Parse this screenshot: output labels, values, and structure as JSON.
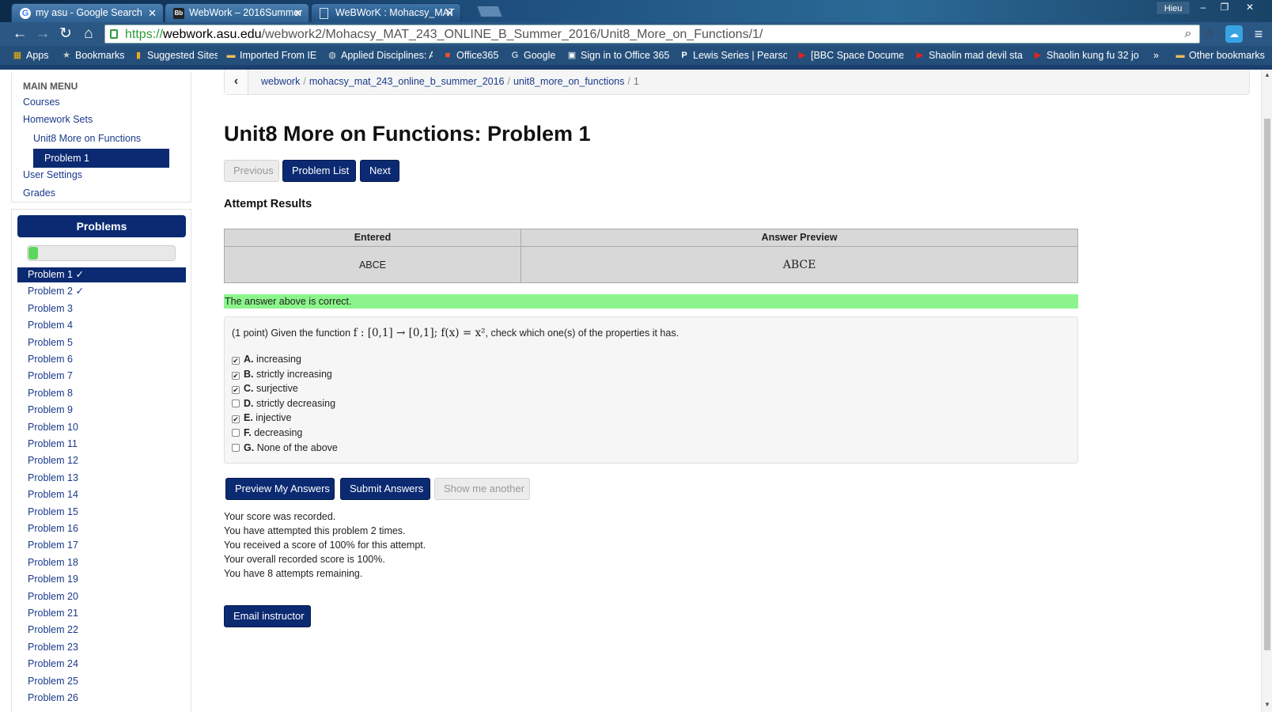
{
  "browser": {
    "tabs": [
      {
        "title": "my asu - Google Search",
        "icon": "google-icon"
      },
      {
        "title": "WebWork – 2016Summer",
        "icon": "blackboard-icon"
      },
      {
        "title": "WeBWorK : Mohacsy_MAT",
        "icon": "document-icon"
      }
    ],
    "window_user": "Hieu",
    "url_scheme": "https://",
    "url_host": "webwork.asu.edu",
    "url_path": "/webwork2/Mohacsy_MAT_243_ONLINE_B_Summer_2016/Unit8_More_on_Functions/1/",
    "bookmarks": [
      {
        "label": "Apps",
        "icon": "apps-grid-icon"
      },
      {
        "label": "Bookmarks",
        "icon": "star-icon"
      },
      {
        "label": "Suggested Sites",
        "icon": "suggested-sites-icon"
      },
      {
        "label": "Imported From IE",
        "icon": "folder-icon"
      },
      {
        "label": "Applied Disciplines: A",
        "icon": "globe-icon"
      },
      {
        "label": "Office365",
        "icon": "office-icon"
      },
      {
        "label": "Google",
        "icon": "google-icon"
      },
      {
        "label": "Sign in to Office 365",
        "icon": "office-icon"
      },
      {
        "label": "Lewis Series | Pearson",
        "icon": "pearson-icon"
      },
      {
        "label": "[BBC Space Documen",
        "icon": "youtube-icon"
      },
      {
        "label": "Shaolin mad devil sta",
        "icon": "youtube-icon"
      },
      {
        "label": "Shaolin kung fu 32 jo",
        "icon": "youtube-icon"
      },
      {
        "label": "Other bookmarks",
        "icon": "folder-icon"
      }
    ],
    "bookmarks_overflow": "»"
  },
  "sidebar": {
    "main_menu_heading": "MAIN MENU",
    "links": {
      "courses": "Courses",
      "homework_sets": "Homework Sets",
      "unit": "Unit8 More on Functions",
      "problem": "Problem 1",
      "user_settings": "User Settings",
      "grades": "Grades"
    },
    "problems_heading": "Problems",
    "progress_fraction": 0.05,
    "problems": [
      "Problem 1 ✓",
      "Problem 2 ✓",
      "Problem 3",
      "Problem 4",
      "Problem 5",
      "Problem 6",
      "Problem 7",
      "Problem 8",
      "Problem 9",
      "Problem 10",
      "Problem 11",
      "Problem 12",
      "Problem 13",
      "Problem 14",
      "Problem 15",
      "Problem 16",
      "Problem 17",
      "Problem 18",
      "Problem 19",
      "Problem 20",
      "Problem 21",
      "Problem 22",
      "Problem 23",
      "Problem 24",
      "Problem 25",
      "Problem 26"
    ],
    "active_problem_index": 0
  },
  "breadcrumb": {
    "back_icon": "chevron-left-icon",
    "items": [
      "webwork",
      "mohacsy_mat_243_online_b_summer_2016",
      "unit8_more_on_functions"
    ],
    "current": "1"
  },
  "page": {
    "title": "Unit8 More on Functions: Problem 1",
    "nav": {
      "previous": "Previous",
      "problem_list": "Problem List",
      "next": "Next"
    },
    "attempt_results_heading": "Attempt Results",
    "results_table": {
      "headers": [
        "Entered",
        "Answer Preview"
      ],
      "entered": "ABCE",
      "preview": "ABCE"
    },
    "correct_message": "The answer above is correct.",
    "problem": {
      "prefix": "(1 point) Given the function ",
      "math": "f : [0,1] → [0,1]; f(x) = x²",
      "suffix": ", check which one(s) of the properties it has.",
      "choices": [
        {
          "letter": "A.",
          "text": "increasing",
          "checked": true
        },
        {
          "letter": "B.",
          "text": "strictly increasing",
          "checked": true
        },
        {
          "letter": "C.",
          "text": "surjective",
          "checked": true
        },
        {
          "letter": "D.",
          "text": "strictly decreasing",
          "checked": false
        },
        {
          "letter": "E.",
          "text": "injective",
          "checked": true
        },
        {
          "letter": "F.",
          "text": "decreasing",
          "checked": false
        },
        {
          "letter": "G.",
          "text": "None of the above",
          "checked": false
        }
      ]
    },
    "actions": {
      "preview": "Preview My Answers",
      "submit": "Submit Answers",
      "show_another": "Show me another"
    },
    "score_messages": [
      "Your score was recorded.",
      "You have attempted this problem 2 times.",
      "You received a score of 100% for this attempt.",
      "Your overall recorded score is 100%.",
      "You have 8 attempts remaining."
    ],
    "email_instructor": "Email instructor"
  }
}
